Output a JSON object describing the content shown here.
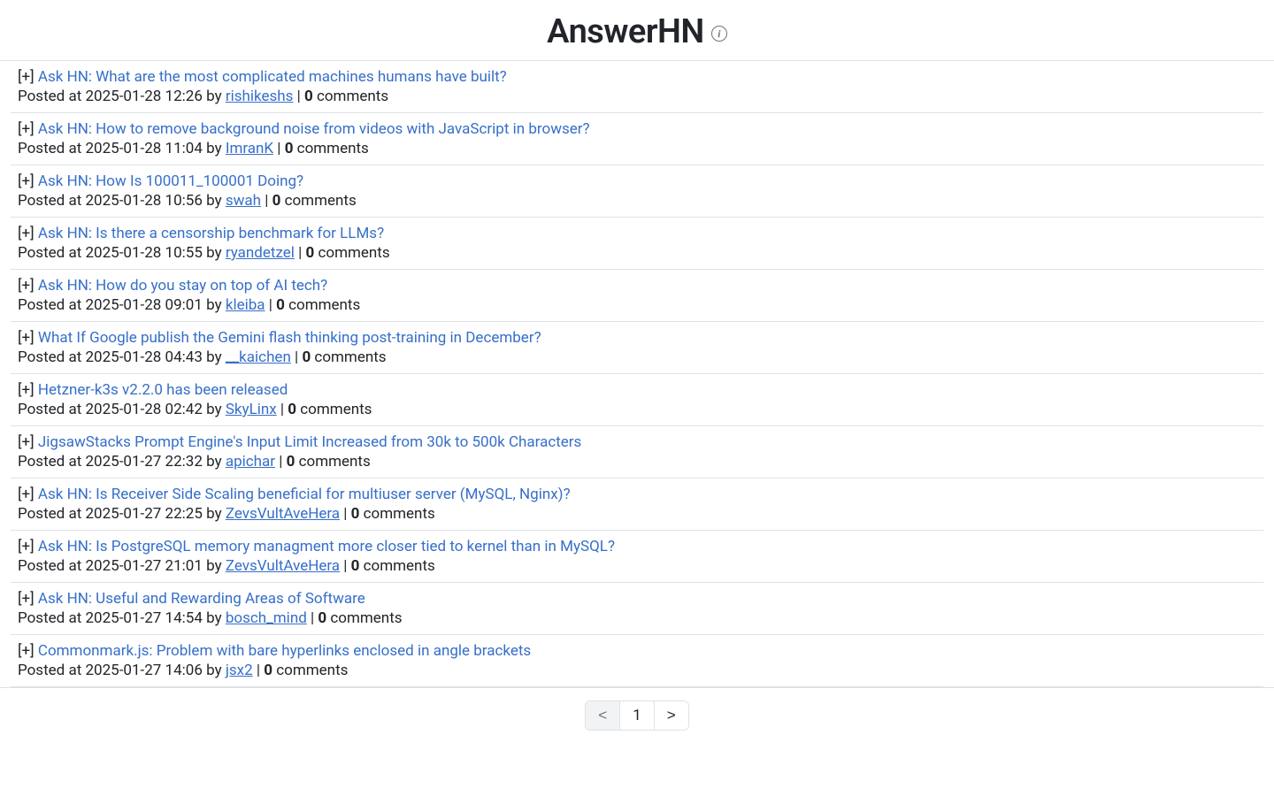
{
  "header": {
    "title": "AnswerHN"
  },
  "labels": {
    "expander": "[+]",
    "posted_at": "Posted at",
    "by": "by",
    "sep": " | ",
    "comments_word": "comments"
  },
  "pagination": {
    "prev": "<",
    "next": ">",
    "current": "1"
  },
  "posts": [
    {
      "title": "Ask HN: What are the most complicated machines humans have built?",
      "time": "2025-01-28 12:26",
      "author": "rishikeshs",
      "comments": 0
    },
    {
      "title": "Ask HN: How to remove background noise from videos with JavaScript in browser?",
      "time": "2025-01-28 11:04",
      "author": "ImranK",
      "comments": 0
    },
    {
      "title": "Ask HN: How Is 100011_100001 Doing?",
      "time": "2025-01-28 10:56",
      "author": "swah",
      "comments": 0
    },
    {
      "title": "Ask HN: Is there a censorship benchmark for LLMs?",
      "time": "2025-01-28 10:55",
      "author": "ryandetzel",
      "comments": 0
    },
    {
      "title": "Ask HN: How do you stay on top of AI tech?",
      "time": "2025-01-28 09:01",
      "author": "kleiba",
      "comments": 0
    },
    {
      "title": "What If Google publish the Gemini flash thinking post-training in December?",
      "time": "2025-01-28 04:43",
      "author": "__kaichen",
      "comments": 0
    },
    {
      "title": "Hetzner-k3s v2.2.0 has been released",
      "time": "2025-01-28 02:42",
      "author": "SkyLinx",
      "comments": 0
    },
    {
      "title": "JigsawStacks Prompt Engine's Input Limit Increased from 30k to 500k Characters",
      "time": "2025-01-27 22:32",
      "author": "apichar",
      "comments": 0
    },
    {
      "title": "Ask HN: Is Receiver Side Scaling beneficial for multiuser server (MySQL, Nginx)?",
      "time": "2025-01-27 22:25",
      "author": "ZevsVultAveHera",
      "comments": 0
    },
    {
      "title": "Ask HN: Is PostgreSQL memory managment more closer tied to kernel than in MySQL?",
      "time": "2025-01-27 21:01",
      "author": "ZevsVultAveHera",
      "comments": 0
    },
    {
      "title": "Ask HN: Useful and Rewarding Areas of Software",
      "time": "2025-01-27 14:54",
      "author": "bosch_mind",
      "comments": 0
    },
    {
      "title": "Commonmark.js: Problem with bare hyperlinks enclosed in angle brackets",
      "time": "2025-01-27 14:06",
      "author": "jsx2",
      "comments": 0
    }
  ]
}
